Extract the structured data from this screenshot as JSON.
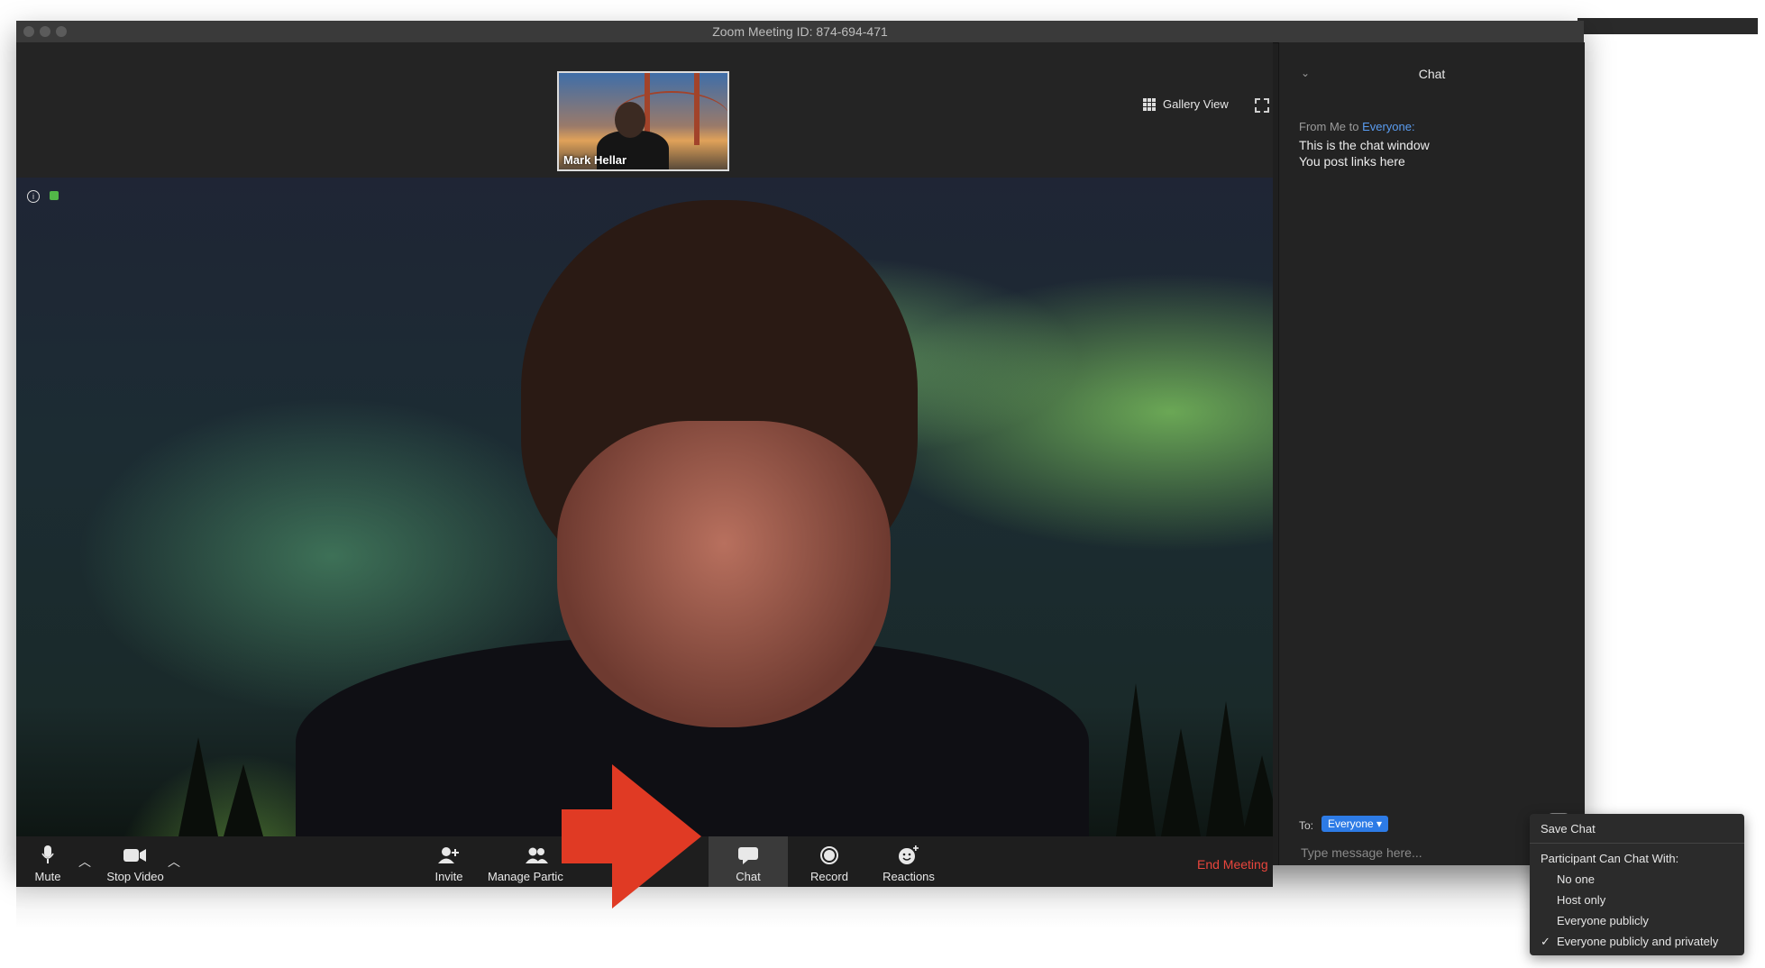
{
  "window": {
    "title": "Zoom Meeting ID: 874-694-471"
  },
  "thumbnail": {
    "name": "Mark Hellar"
  },
  "view": {
    "gallery_label": "Gallery View"
  },
  "toolbar": {
    "mute": "Mute",
    "stop_video": "Stop Video",
    "invite": "Invite",
    "manage": "Manage Partic",
    "chat": "Chat",
    "record": "Record",
    "reactions": "Reactions",
    "end_meeting": "End Meeting"
  },
  "chat": {
    "title": "Chat",
    "from_prefix": "From Me to ",
    "from_target": "Everyone:",
    "messages": [
      "This is the chat window",
      "You post links here"
    ],
    "to_label": "To:",
    "to_value": "Everyone",
    "placeholder": "Type message here..."
  },
  "menu": {
    "save_chat": "Save Chat",
    "heading": "Participant Can Chat With:",
    "options": [
      "No one",
      "Host only",
      "Everyone publicly",
      "Everyone publicly and privately"
    ],
    "selected_index": 3
  },
  "colors": {
    "end_meeting": "#e8453c",
    "accent_blue": "#2d7be6",
    "arrow": "#e03a24"
  }
}
